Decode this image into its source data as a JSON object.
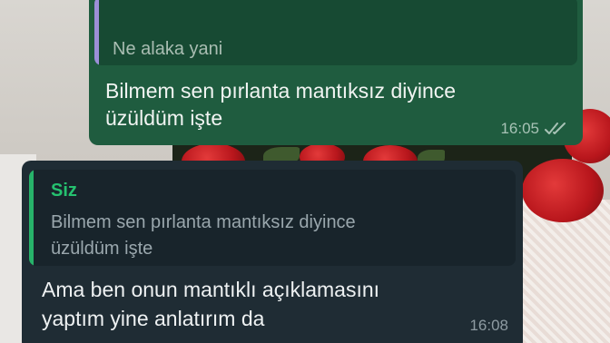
{
  "outgoing": {
    "quoted_text": "Ne alaka yani",
    "text_line1": "Bilmem sen pırlanta mantıksız diyince",
    "text_line2": "üzüldüm işte",
    "time": "16:05",
    "status_icon": "double-check-icon"
  },
  "incoming": {
    "quoted_sender": "Siz",
    "quoted_line1": "Bilmem sen pırlanta mantıksız diyince",
    "quoted_line2": "üzüldüm işte",
    "text_line1": "Ama ben onun mantıklı açıklamasını",
    "text_line2": "yaptım yine anlatırım da",
    "time": "16:08"
  },
  "colors": {
    "outgoing_bubble": "#1f5c3f",
    "incoming_bubble": "#1f2c34",
    "quote_bar_out": "#9c8fd8",
    "quote_bar_in": "#27b36a"
  }
}
